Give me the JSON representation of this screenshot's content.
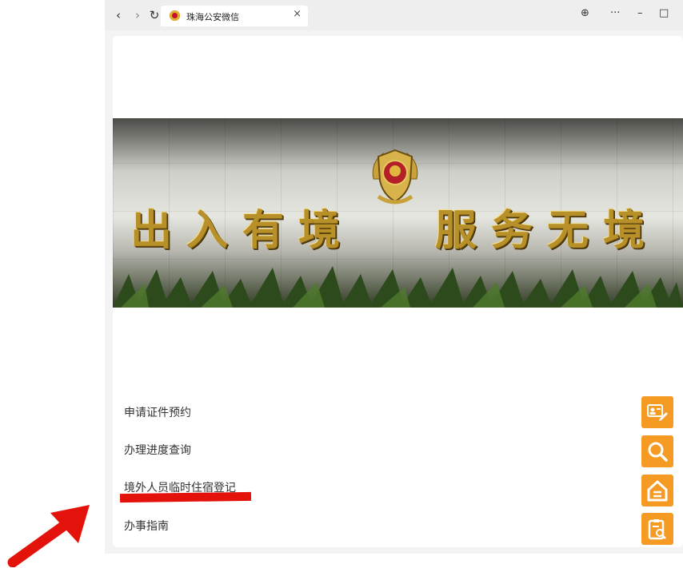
{
  "browser": {
    "tab": {
      "title": "珠海公安微信",
      "close_glyph": "×"
    },
    "nav": {
      "back_glyph": "‹",
      "forward_glyph": "›",
      "refresh_glyph": "↻"
    },
    "window_controls": {
      "globe_glyph": "⊕",
      "more_glyph": "···",
      "minimize_glyph": "–",
      "maximize_glyph": "□"
    }
  },
  "banner": {
    "slogan_left": "出入有境",
    "slogan_right": "服务无境"
  },
  "menu": {
    "items": [
      {
        "label": "申请证件预约"
      },
      {
        "label": "办理进度查询"
      },
      {
        "label": "境外人员临时住宿登记"
      },
      {
        "label": "办事指南"
      }
    ]
  },
  "side_buttons": [
    {
      "icon": "id-card-edit-icon"
    },
    {
      "icon": "search-icon"
    },
    {
      "icon": "home-icon"
    },
    {
      "icon": "clipboard-search-icon"
    }
  ],
  "annotations": {
    "highlight_color": "#e3120b",
    "arrow_color": "#e3120b"
  },
  "colors": {
    "accent": "#f59a23"
  }
}
